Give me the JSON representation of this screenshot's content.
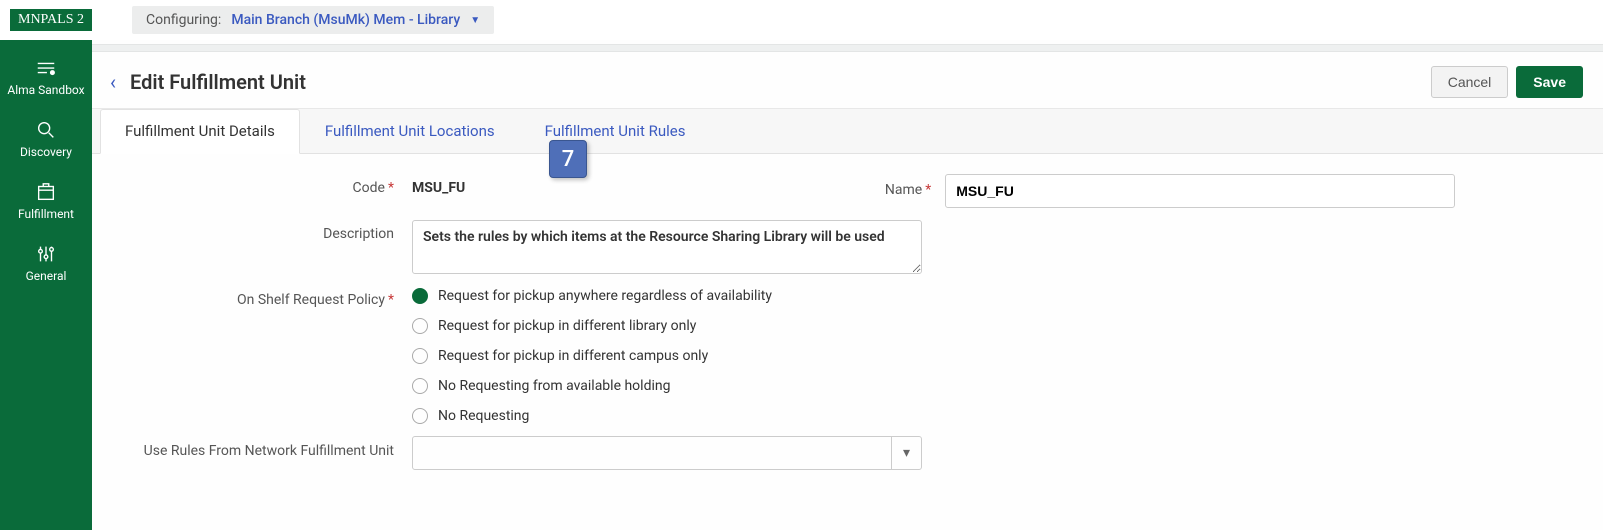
{
  "logo": {
    "text": "MNPALS 2"
  },
  "configuring": {
    "label": "Configuring:",
    "value": "Main Branch (MsuMk) Mem - Library"
  },
  "sidebar": {
    "items": [
      {
        "label": "Alma Sandbox",
        "icon": "sandbox-icon"
      },
      {
        "label": "Discovery",
        "icon": "discovery-icon"
      },
      {
        "label": "Fulfillment",
        "icon": "fulfillment-icon"
      },
      {
        "label": "General",
        "icon": "general-icon"
      }
    ]
  },
  "page": {
    "title": "Edit Fulfillment Unit",
    "cancel": "Cancel",
    "save": "Save"
  },
  "tabs": [
    {
      "label": "Fulfillment Unit Details",
      "active": true
    },
    {
      "label": "Fulfillment Unit Locations",
      "active": false
    },
    {
      "label": "Fulfillment Unit Rules",
      "active": false
    }
  ],
  "callout": {
    "number": "7"
  },
  "form": {
    "code_label": "Code",
    "code_value": "MSU_FU",
    "name_label": "Name",
    "name_value": "MSU_FU",
    "description_label": "Description",
    "description_value": "Sets the rules by which items at the Resource Sharing Library will be used",
    "policy_label": "On Shelf Request Policy",
    "policy_options": [
      {
        "label": "Request for pickup anywhere regardless of availability",
        "selected": true
      },
      {
        "label": "Request for pickup in different library only",
        "selected": false
      },
      {
        "label": "Request for pickup in different campus only",
        "selected": false
      },
      {
        "label": "No Requesting from available holding",
        "selected": false
      },
      {
        "label": "No Requesting",
        "selected": false
      }
    ],
    "network_rules_label": "Use Rules From Network Fulfillment Unit",
    "network_rules_value": ""
  }
}
